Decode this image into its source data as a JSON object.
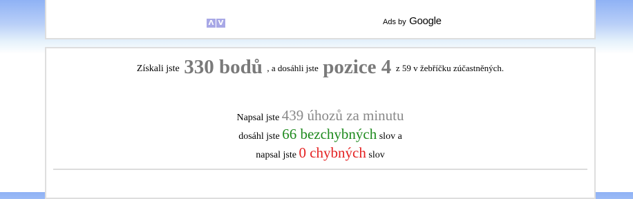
{
  "ad": {
    "adchoice_icons": [
      "Λ",
      "V"
    ],
    "ads_by_text": "Ads by",
    "google_text": "Google"
  },
  "result": {
    "intro": "Získali jste",
    "points": "330 bodů",
    "mid": ", a dosáhli jste",
    "position": "pozice 4",
    "tail": "z 59 v žebříčku zúčastněných."
  },
  "stats": {
    "speed_prefix": "Napsal jste",
    "speed_value": "439 úhozů za minutu",
    "correct_prefix": "dosáhl jste",
    "correct_value": "66 bezchybných",
    "correct_suffix": "slov a",
    "errors_prefix": "napsal jste",
    "errors_value": "0 chybných",
    "errors_suffix": "slov"
  },
  "colors": {
    "header_gradient_top": "#8fb2f5",
    "value_gray": "#888888",
    "value_green": "#1e8a1e",
    "value_red": "#e42020"
  }
}
